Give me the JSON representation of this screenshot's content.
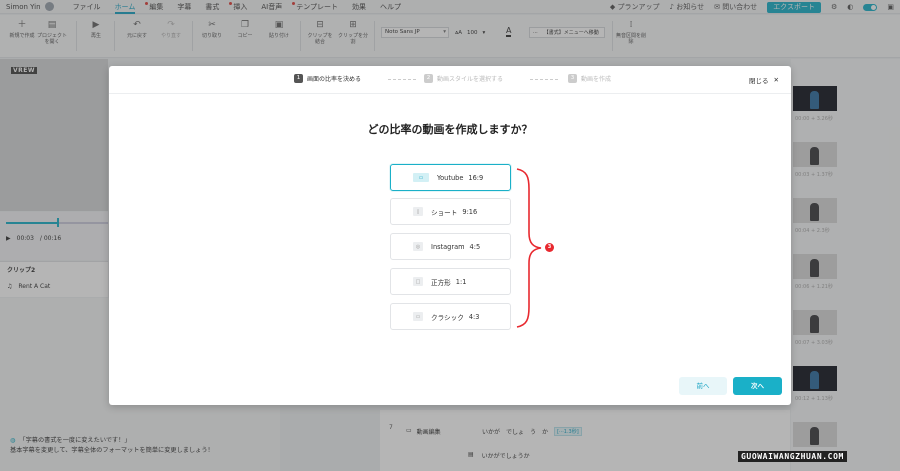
{
  "menubar": {
    "user_name": "Simon Yin",
    "items": [
      {
        "label": "ファイル",
        "dot": false
      },
      {
        "label": "ホーム",
        "dot": false,
        "active": true
      },
      {
        "label": "編集",
        "dot": true
      },
      {
        "label": "字幕",
        "dot": false
      },
      {
        "label": "書式",
        "dot": false
      },
      {
        "label": "挿入",
        "dot": true
      },
      {
        "label": "AI音声",
        "dot": false
      },
      {
        "label": "テンプレート",
        "dot": true
      },
      {
        "label": "効果",
        "dot": false
      },
      {
        "label": "ヘルプ",
        "dot": false
      }
    ],
    "plan_label": "プランアップ",
    "notice_label": "お知らせ",
    "contact_label": "問い合わせ",
    "export_label": "エクスポート"
  },
  "toolbar": {
    "new_project": "新規で作成",
    "open_project": "プロジェクトを開く",
    "play": "再生",
    "undo": "元に戻す",
    "redo": "やり直す",
    "cut": "切り取り",
    "copy": "コピー",
    "paste": "貼り付け",
    "merge_clip": "クリップを結合",
    "split_clip": "クリップを分割",
    "font_value": "Noto Sans JP",
    "size_value": "100",
    "style_menu": "【書式】メニューへ移動",
    "ruby_toggle": "無音区間を削除"
  },
  "player": {
    "current_time": "00:03",
    "total_time": "/ 00:16"
  },
  "clip_panel": {
    "title": "クリップ2",
    "music": "Rent A Cat"
  },
  "tip": {
    "line1": "「字幕の書式を一度に変えたいです！」",
    "line2": "基本字幕を変更して、字幕全体のフォーマットを簡単に変更しましょう！"
  },
  "thumbs": [
    {
      "label": "00:00 + 3.26秒",
      "dark": true
    },
    {
      "label": "00:03 + 1.37秒",
      "dark": false
    },
    {
      "label": "00:04 + 2.3秒",
      "dark": false
    },
    {
      "label": "00:06 + 1.21秒",
      "dark": false
    },
    {
      "label": "00:07 + 3.03秒",
      "dark": false
    },
    {
      "label": "00:12 + 1.13秒",
      "dark": true
    },
    {
      "label": "",
      "dark": false
    }
  ],
  "timeline": {
    "row_number": "7",
    "clip_label": "動画編集",
    "words": [
      "いかが",
      "でしょ",
      "う",
      "か"
    ],
    "duration_badge": "[···1.3秒]",
    "subtitle": "いかがでしょうか"
  },
  "dialog": {
    "steps": [
      {
        "num": "1",
        "label": "画面の比率を決める",
        "active": true
      },
      {
        "num": "2",
        "label": "動画スタイルを選択する",
        "active": false
      },
      {
        "num": "3",
        "label": "動画を作成",
        "active": false
      }
    ],
    "close_label": "閉じる",
    "title": "どの比率の動画を作成しますか？",
    "options": [
      {
        "name": "Youtube",
        "ratio": "16:9",
        "icon": "video-icon",
        "glyph": "▭",
        "selected": true
      },
      {
        "name": "ショート",
        "ratio": "9:16",
        "icon": "phone-icon",
        "glyph": "▯",
        "selected": false
      },
      {
        "name": "Instagram",
        "ratio": "4:5",
        "icon": "instagram-icon",
        "glyph": "◎",
        "selected": false
      },
      {
        "name": "正方形",
        "ratio": "1:1",
        "icon": "square-icon",
        "glyph": "□",
        "selected": false
      },
      {
        "name": "クラシック",
        "ratio": "4:3",
        "icon": "classic-icon",
        "glyph": "▭",
        "selected": false
      }
    ],
    "annotation_badge": "3",
    "prev_label": "前へ",
    "next_label": "次へ"
  },
  "watermark": "GUOWAIWANGZHUAN.COM",
  "colors": {
    "accent": "#1ab0c8",
    "annotation": "#e8292f"
  }
}
